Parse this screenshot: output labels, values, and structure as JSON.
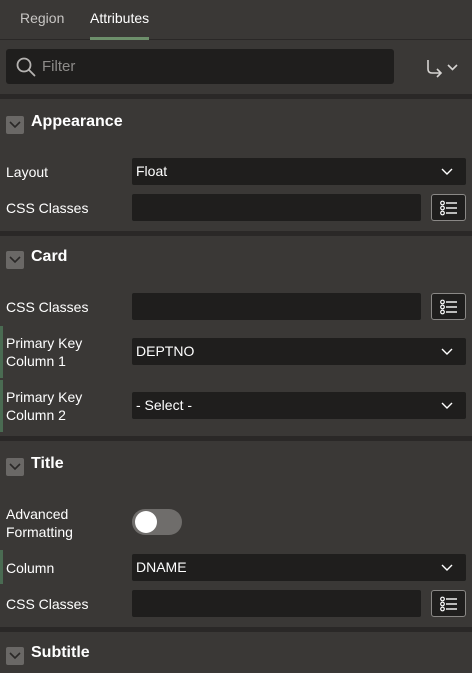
{
  "tabs": [
    {
      "label": "Region",
      "active": false
    },
    {
      "label": "Attributes",
      "active": true
    }
  ],
  "filter": {
    "placeholder": "Filter",
    "value": ""
  },
  "colors": {
    "background": "#3a3836",
    "field": "#1f1e1d",
    "tab_underline": "#6d8f6b",
    "required_accent": "#4a6b52"
  },
  "sections": {
    "appearance": {
      "title": "Appearance",
      "layout_label": "Layout",
      "layout_value": "Float",
      "css_classes_label": "CSS Classes",
      "css_classes_value": ""
    },
    "card": {
      "title": "Card",
      "css_classes_label": "CSS Classes",
      "css_classes_value": "",
      "pk1_label_line1": "Primary Key",
      "pk1_label_line2": "Column 1",
      "pk1_value": "DEPTNO",
      "pk2_label_line1": "Primary Key",
      "pk2_label_line2": "Column 2",
      "pk2_value": "- Select -"
    },
    "title": {
      "title": "Title",
      "adv_label_line1": "Advanced",
      "adv_label_line2": "Formatting",
      "adv_enabled": false,
      "column_label": "Column",
      "column_value": "DNAME",
      "css_classes_label": "CSS Classes",
      "css_classes_value": ""
    },
    "subtitle": {
      "title": "Subtitle"
    }
  }
}
